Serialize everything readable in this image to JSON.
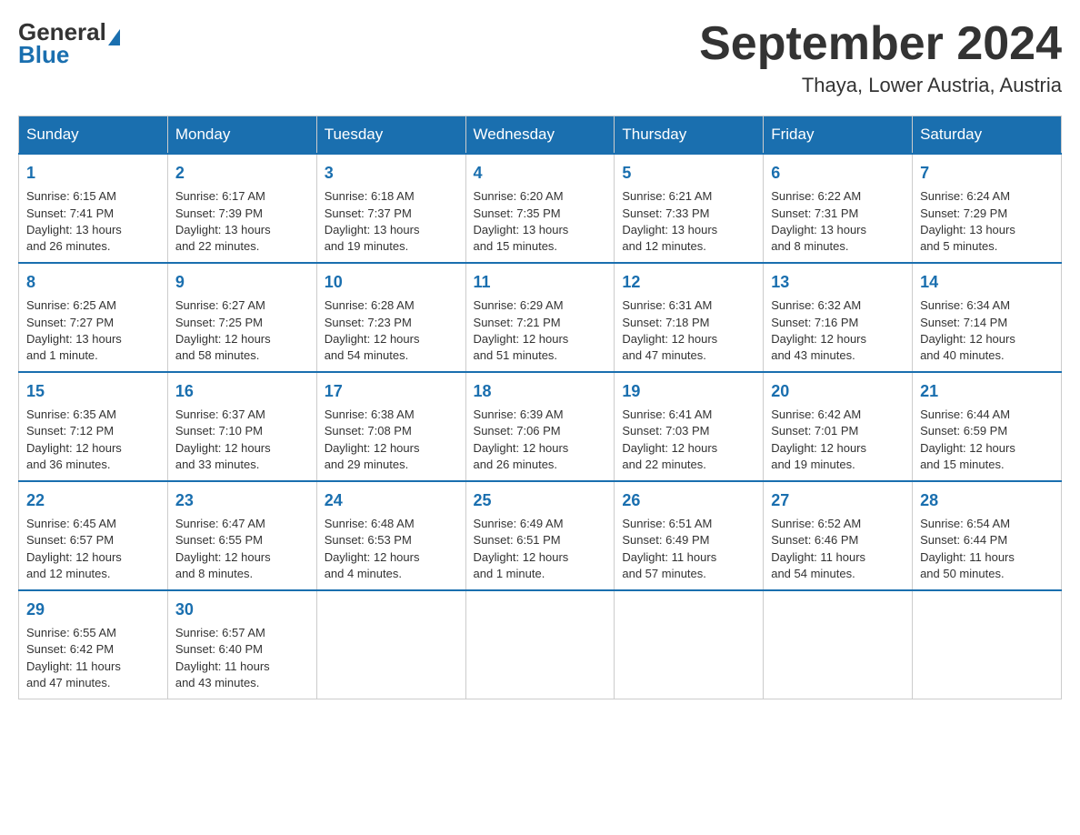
{
  "logo": {
    "general": "General",
    "triangle": "▲",
    "blue": "Blue"
  },
  "title": "September 2024",
  "subtitle": "Thaya, Lower Austria, Austria",
  "days_of_week": [
    "Sunday",
    "Monday",
    "Tuesday",
    "Wednesday",
    "Thursday",
    "Friday",
    "Saturday"
  ],
  "weeks": [
    [
      {
        "day": "1",
        "info": "Sunrise: 6:15 AM\nSunset: 7:41 PM\nDaylight: 13 hours\nand 26 minutes."
      },
      {
        "day": "2",
        "info": "Sunrise: 6:17 AM\nSunset: 7:39 PM\nDaylight: 13 hours\nand 22 minutes."
      },
      {
        "day": "3",
        "info": "Sunrise: 6:18 AM\nSunset: 7:37 PM\nDaylight: 13 hours\nand 19 minutes."
      },
      {
        "day": "4",
        "info": "Sunrise: 6:20 AM\nSunset: 7:35 PM\nDaylight: 13 hours\nand 15 minutes."
      },
      {
        "day": "5",
        "info": "Sunrise: 6:21 AM\nSunset: 7:33 PM\nDaylight: 13 hours\nand 12 minutes."
      },
      {
        "day": "6",
        "info": "Sunrise: 6:22 AM\nSunset: 7:31 PM\nDaylight: 13 hours\nand 8 minutes."
      },
      {
        "day": "7",
        "info": "Sunrise: 6:24 AM\nSunset: 7:29 PM\nDaylight: 13 hours\nand 5 minutes."
      }
    ],
    [
      {
        "day": "8",
        "info": "Sunrise: 6:25 AM\nSunset: 7:27 PM\nDaylight: 13 hours\nand 1 minute."
      },
      {
        "day": "9",
        "info": "Sunrise: 6:27 AM\nSunset: 7:25 PM\nDaylight: 12 hours\nand 58 minutes."
      },
      {
        "day": "10",
        "info": "Sunrise: 6:28 AM\nSunset: 7:23 PM\nDaylight: 12 hours\nand 54 minutes."
      },
      {
        "day": "11",
        "info": "Sunrise: 6:29 AM\nSunset: 7:21 PM\nDaylight: 12 hours\nand 51 minutes."
      },
      {
        "day": "12",
        "info": "Sunrise: 6:31 AM\nSunset: 7:18 PM\nDaylight: 12 hours\nand 47 minutes."
      },
      {
        "day": "13",
        "info": "Sunrise: 6:32 AM\nSunset: 7:16 PM\nDaylight: 12 hours\nand 43 minutes."
      },
      {
        "day": "14",
        "info": "Sunrise: 6:34 AM\nSunset: 7:14 PM\nDaylight: 12 hours\nand 40 minutes."
      }
    ],
    [
      {
        "day": "15",
        "info": "Sunrise: 6:35 AM\nSunset: 7:12 PM\nDaylight: 12 hours\nand 36 minutes."
      },
      {
        "day": "16",
        "info": "Sunrise: 6:37 AM\nSunset: 7:10 PM\nDaylight: 12 hours\nand 33 minutes."
      },
      {
        "day": "17",
        "info": "Sunrise: 6:38 AM\nSunset: 7:08 PM\nDaylight: 12 hours\nand 29 minutes."
      },
      {
        "day": "18",
        "info": "Sunrise: 6:39 AM\nSunset: 7:06 PM\nDaylight: 12 hours\nand 26 minutes."
      },
      {
        "day": "19",
        "info": "Sunrise: 6:41 AM\nSunset: 7:03 PM\nDaylight: 12 hours\nand 22 minutes."
      },
      {
        "day": "20",
        "info": "Sunrise: 6:42 AM\nSunset: 7:01 PM\nDaylight: 12 hours\nand 19 minutes."
      },
      {
        "day": "21",
        "info": "Sunrise: 6:44 AM\nSunset: 6:59 PM\nDaylight: 12 hours\nand 15 minutes."
      }
    ],
    [
      {
        "day": "22",
        "info": "Sunrise: 6:45 AM\nSunset: 6:57 PM\nDaylight: 12 hours\nand 12 minutes."
      },
      {
        "day": "23",
        "info": "Sunrise: 6:47 AM\nSunset: 6:55 PM\nDaylight: 12 hours\nand 8 minutes."
      },
      {
        "day": "24",
        "info": "Sunrise: 6:48 AM\nSunset: 6:53 PM\nDaylight: 12 hours\nand 4 minutes."
      },
      {
        "day": "25",
        "info": "Sunrise: 6:49 AM\nSunset: 6:51 PM\nDaylight: 12 hours\nand 1 minute."
      },
      {
        "day": "26",
        "info": "Sunrise: 6:51 AM\nSunset: 6:49 PM\nDaylight: 11 hours\nand 57 minutes."
      },
      {
        "day": "27",
        "info": "Sunrise: 6:52 AM\nSunset: 6:46 PM\nDaylight: 11 hours\nand 54 minutes."
      },
      {
        "day": "28",
        "info": "Sunrise: 6:54 AM\nSunset: 6:44 PM\nDaylight: 11 hours\nand 50 minutes."
      }
    ],
    [
      {
        "day": "29",
        "info": "Sunrise: 6:55 AM\nSunset: 6:42 PM\nDaylight: 11 hours\nand 47 minutes."
      },
      {
        "day": "30",
        "info": "Sunrise: 6:57 AM\nSunset: 6:40 PM\nDaylight: 11 hours\nand 43 minutes."
      },
      {
        "day": "",
        "info": ""
      },
      {
        "day": "",
        "info": ""
      },
      {
        "day": "",
        "info": ""
      },
      {
        "day": "",
        "info": ""
      },
      {
        "day": "",
        "info": ""
      }
    ]
  ]
}
